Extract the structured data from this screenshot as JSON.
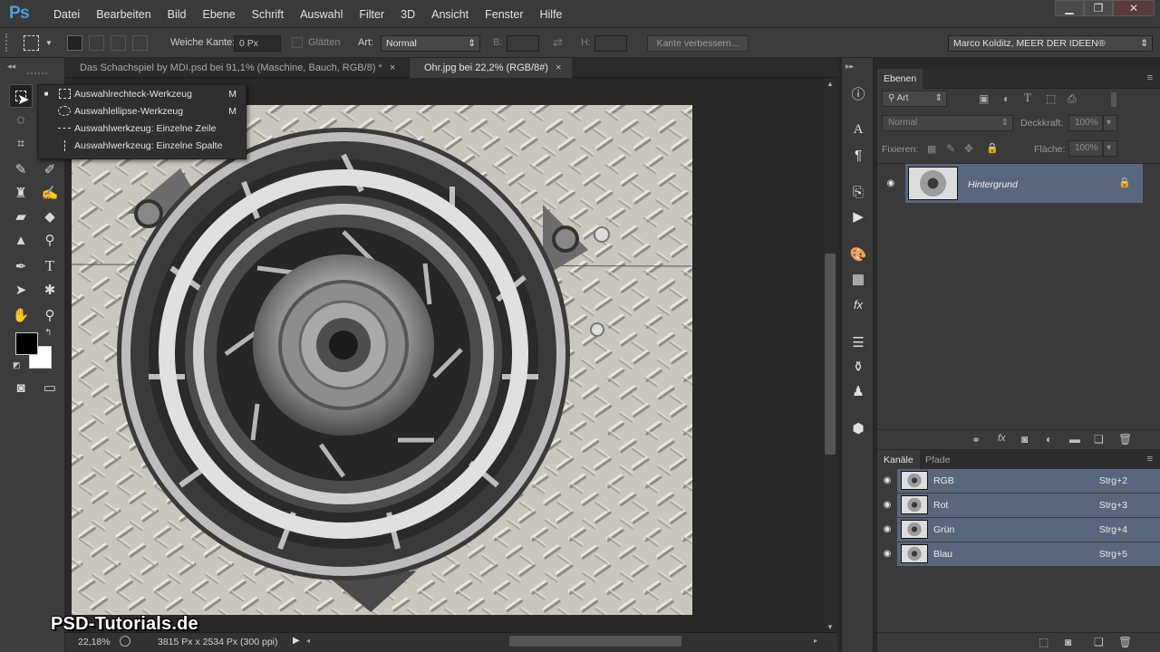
{
  "app": {
    "logo": "Ps"
  },
  "menu": [
    "Datei",
    "Bearbeiten",
    "Bild",
    "Ebene",
    "Schrift",
    "Auswahl",
    "Filter",
    "3D",
    "Ansicht",
    "Fenster",
    "Hilfe"
  ],
  "window_controls": {
    "minimize": "▁",
    "maximize": "❐",
    "close": "✕"
  },
  "options": {
    "weiche_kante_label": "Weiche Kante:",
    "weiche_kante_value": "0 Px",
    "glaetten_label": "Glätten",
    "art_label": "Art:",
    "art_value": "Normal",
    "b_label": "B:",
    "h_label": "H:",
    "kante_button": "Kante verbessern...",
    "workspace": "Marco Kolditz, MEER DER IDEEN®"
  },
  "tabs": [
    {
      "label": "Das Schachspiel by MDI.psd bei 91,1% (Maschine, Bauch, RGB/8) *",
      "close": "×"
    },
    {
      "label": "Ohr.jpg bei 22,2% (RGB/8#)",
      "close": "×"
    }
  ],
  "flyout": [
    {
      "label": "Auswahlrechteck-Werkzeug",
      "shortcut": "M",
      "bullet": "■"
    },
    {
      "label": "Auswahlellipse-Werkzeug",
      "shortcut": "M",
      "bullet": ""
    },
    {
      "label": "Auswahlwerkzeug: Einzelne Zeile",
      "shortcut": "",
      "bullet": ""
    },
    {
      "label": "Auswahlwerkzeug: Einzelne Spalte",
      "shortcut": "",
      "bullet": ""
    }
  ],
  "status": {
    "zoom": "22,18%",
    "doc_info": "3815 Px x 2534 Px (300 ppi)"
  },
  "layers_panel": {
    "tab": "Ebenen",
    "filter_kind": "Art",
    "blend_mode": "Normal",
    "opacity_label": "Deckkraft:",
    "opacity_value": "100%",
    "lock_label": "Fixieren:",
    "fill_label": "Fläche:",
    "fill_value": "100%",
    "layers": [
      {
        "name": "Hintergrund"
      }
    ]
  },
  "channels_panel": {
    "tabs": [
      "Kanäle",
      "Pfade"
    ],
    "channels": [
      {
        "name": "RGB",
        "shortcut": "Strg+2"
      },
      {
        "name": "Rot",
        "shortcut": "Strg+3"
      },
      {
        "name": "Grün",
        "shortcut": "Strg+4"
      },
      {
        "name": "Blau",
        "shortcut": "Strg+5"
      }
    ]
  },
  "watermark": "PSD-Tutorials.de",
  "colors": {
    "accent": "#4aa3df",
    "selected_row": "#59677e",
    "panel_bg": "#3a3a3a"
  }
}
